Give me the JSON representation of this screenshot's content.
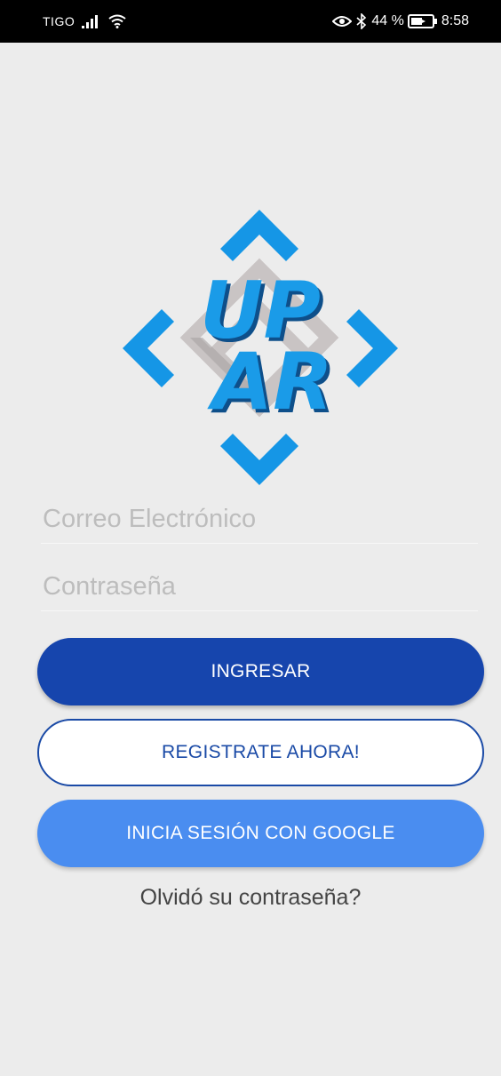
{
  "status_bar": {
    "carrier": "TIGO",
    "battery": "44 %",
    "time": "8:58",
    "icons": [
      "signal-icon",
      "wifi-icon",
      "eye-icon",
      "bluetooth-icon",
      "battery-icon"
    ]
  },
  "logo": {
    "line1": "UP",
    "line2": "AR",
    "colors": {
      "arrow": "#1596e6",
      "text": "#1a9be8",
      "text_shadow": "#0e4f8a",
      "frame": "#c9c4c4"
    }
  },
  "login_form": {
    "email_placeholder": "Correo Electrónico",
    "password_placeholder": "Contraseña",
    "ingresar_label": "INGRESAR",
    "registrate_label": "REGISTRATE AHORA!",
    "google_label": "INICIA SESIÓN CON GOOGLE",
    "forgot_label": "Olvidó su contraseña?"
  },
  "colors": {
    "background": "#ececec",
    "ingresar": "#1645ad",
    "registrate_border": "#1a4aa6",
    "google": "#4a8df0"
  }
}
